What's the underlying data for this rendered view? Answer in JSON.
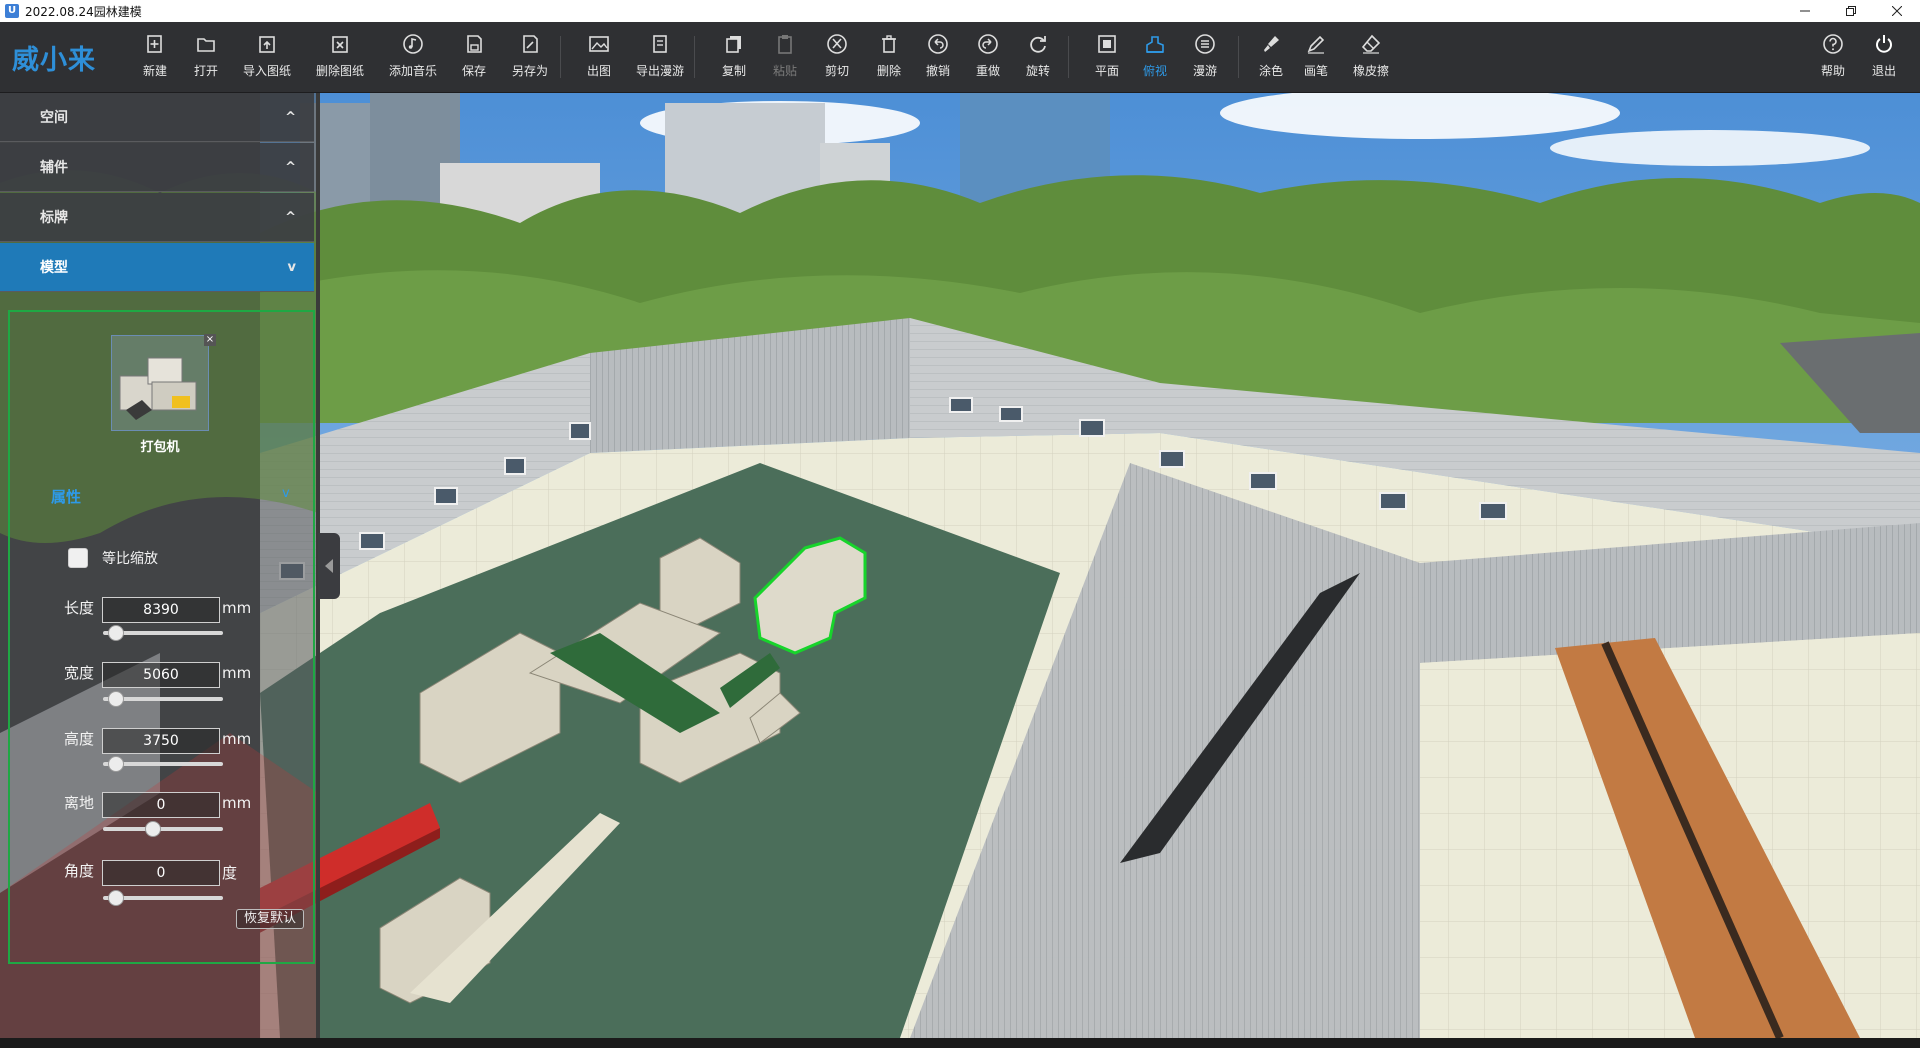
{
  "window": {
    "app_icon": "U",
    "title": "2022.08.24园林建模"
  },
  "brand": "威小来",
  "toolbar": {
    "tools": [
      {
        "label": "新建",
        "icon": "new-file-icon"
      },
      {
        "label": "打开",
        "icon": "folder-icon"
      },
      {
        "label": "导入图纸",
        "icon": "import-drawing-icon"
      },
      {
        "label": "删除图纸",
        "icon": "delete-drawing-icon"
      },
      {
        "label": "添加音乐",
        "icon": "music-note-icon"
      },
      {
        "label": "保存",
        "icon": "save-icon"
      },
      {
        "label": "另存为",
        "icon": "save-as-icon"
      },
      {
        "label": "出图",
        "icon": "picture-icon"
      },
      {
        "label": "导出漫游",
        "icon": "export-tour-icon"
      },
      {
        "label": "复制",
        "icon": "copy-icon"
      },
      {
        "label": "粘贴",
        "icon": "paste-icon",
        "disabled": true
      },
      {
        "label": "剪切",
        "icon": "scissors-icon"
      },
      {
        "label": "删除",
        "icon": "trash-icon"
      },
      {
        "label": "撤销",
        "icon": "undo-icon"
      },
      {
        "label": "重做",
        "icon": "redo-icon"
      },
      {
        "label": "旋转",
        "icon": "rotate-icon"
      },
      {
        "label": "平面",
        "icon": "plan-view-icon"
      },
      {
        "label": "俯视",
        "icon": "top-view-icon",
        "active": true
      },
      {
        "label": "漫游",
        "icon": "tour-icon"
      },
      {
        "label": "涂色",
        "icon": "paint-brush-icon"
      },
      {
        "label": "画笔",
        "icon": "pen-icon"
      },
      {
        "label": "橡皮擦",
        "icon": "eraser-icon"
      },
      {
        "label": "帮助",
        "icon": "help-icon"
      },
      {
        "label": "退出",
        "icon": "power-icon"
      }
    ]
  },
  "sidebar": {
    "sections": [
      {
        "label": "空间",
        "arrow": "^"
      },
      {
        "label": "辅件",
        "arrow": "^"
      },
      {
        "label": "标牌",
        "arrow": "^"
      },
      {
        "label": "模型",
        "arrow": "v",
        "active": true
      }
    ],
    "model": {
      "name": "打包机",
      "close": "×"
    },
    "properties": {
      "title": "属性",
      "arrow": "v",
      "proportional_label": "等比缩放",
      "proportional_checked": false,
      "fields": [
        {
          "label": "长度",
          "value": "8390",
          "unit": "mm",
          "slider": 0.05
        },
        {
          "label": "宽度",
          "value": "5060",
          "unit": "mm",
          "slider": 0.05
        },
        {
          "label": "高度",
          "value": "3750",
          "unit": "mm",
          "slider": 0.05
        },
        {
          "label": "离地",
          "value": "0",
          "unit": "mm",
          "slider": 0.4
        },
        {
          "label": "角度",
          "value": "0",
          "unit": "度",
          "slider": 0.05
        }
      ],
      "reset_label": "恢复默认"
    }
  },
  "colors": {
    "accent": "#2e9ae8",
    "active_section": "#1f7ab8",
    "selection_outline": "#1fa844",
    "toolbar_bg": "#2f3033"
  }
}
